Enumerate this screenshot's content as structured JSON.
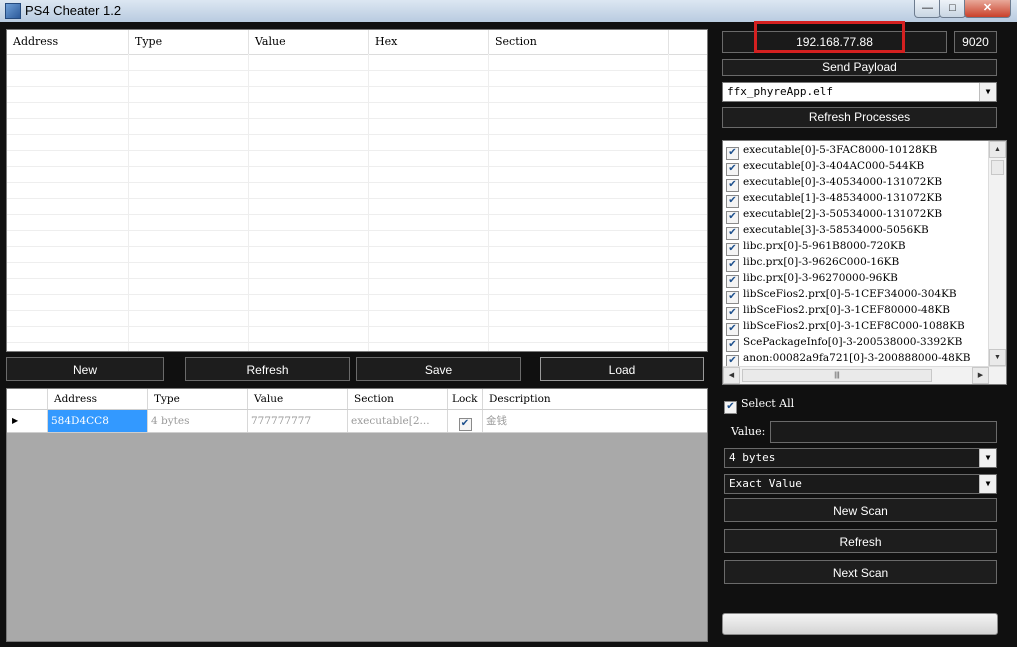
{
  "window": {
    "title": "PS4 Cheater 1.2",
    "minimize_glyph": "—",
    "maximize_glyph": "□",
    "close_glyph": "✕"
  },
  "connection": {
    "ip": "192.168.77.88",
    "port": "9020",
    "highlight_color": "#d42020"
  },
  "buttons": {
    "send_payload": "Send Payload",
    "refresh_processes": "Refresh Processes",
    "new": "New",
    "refresh": "Refresh",
    "save": "Save",
    "load": "Load",
    "new_scan": "New Scan",
    "scan_refresh": "Refresh",
    "next_scan": "Next Scan"
  },
  "process_combo": {
    "value": "ffx_phyreApp.elf"
  },
  "sections": [
    "executable[0]-5-3FAC8000-10128KB",
    "executable[0]-3-404AC000-544KB",
    "executable[0]-3-40534000-131072KB",
    "executable[1]-3-48534000-131072KB",
    "executable[2]-3-50534000-131072KB",
    "executable[3]-3-58534000-5056KB",
    "libc.prx[0]-5-961B8000-720KB",
    "libc.prx[0]-3-9626C000-16KB",
    "libc.prx[0]-3-96270000-96KB",
    "libSceFios2.prx[0]-5-1CEF34000-304KB",
    "libSceFios2.prx[0]-3-1CEF80000-48KB",
    "libSceFios2.prx[0]-3-1CEF8C000-1088KB",
    "ScePackageInfo[0]-3-200538000-3392KB",
    "anon:00082a9fa721[0]-3-200888000-48KB"
  ],
  "select_all": {
    "label": "Select All",
    "checked": true
  },
  "value_input": {
    "label": "Value:",
    "value": ""
  },
  "value_type": {
    "value": "4 bytes"
  },
  "scan_type": {
    "value": "Exact Value"
  },
  "result_table": {
    "columns": [
      "Address",
      "Type",
      "Value",
      "Hex",
      "Section"
    ]
  },
  "cheat_table": {
    "columns": [
      "Address",
      "Type",
      "Value",
      "Section",
      "Lock",
      "Description"
    ],
    "rows": [
      {
        "address": "584D4CC8",
        "type": "4 bytes",
        "value": "777777777",
        "section": "executable[2...",
        "lock": true,
        "description": "金钱"
      }
    ]
  },
  "progress": 0
}
